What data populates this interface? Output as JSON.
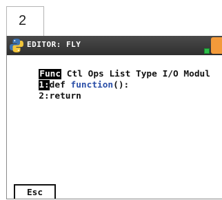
{
  "step": {
    "number": "2"
  },
  "titlebar": {
    "title": "EDITOR: FLY",
    "icon": "python-icon",
    "status_colors": {
      "battery": "#f39a3a",
      "indicator": "#2ebd4a"
    }
  },
  "menu": {
    "items": [
      "Func",
      "Ctl",
      "Ops",
      "List",
      "Type",
      "I/O",
      "Modul"
    ],
    "active_index": 0
  },
  "code": {
    "lines": [
      {
        "num": "1:",
        "keyword": "def",
        "name": "function",
        "rest": "():"
      },
      {
        "num": "2:",
        "text": "return"
      }
    ]
  },
  "softkeys": {
    "esc_label": "Esc"
  }
}
